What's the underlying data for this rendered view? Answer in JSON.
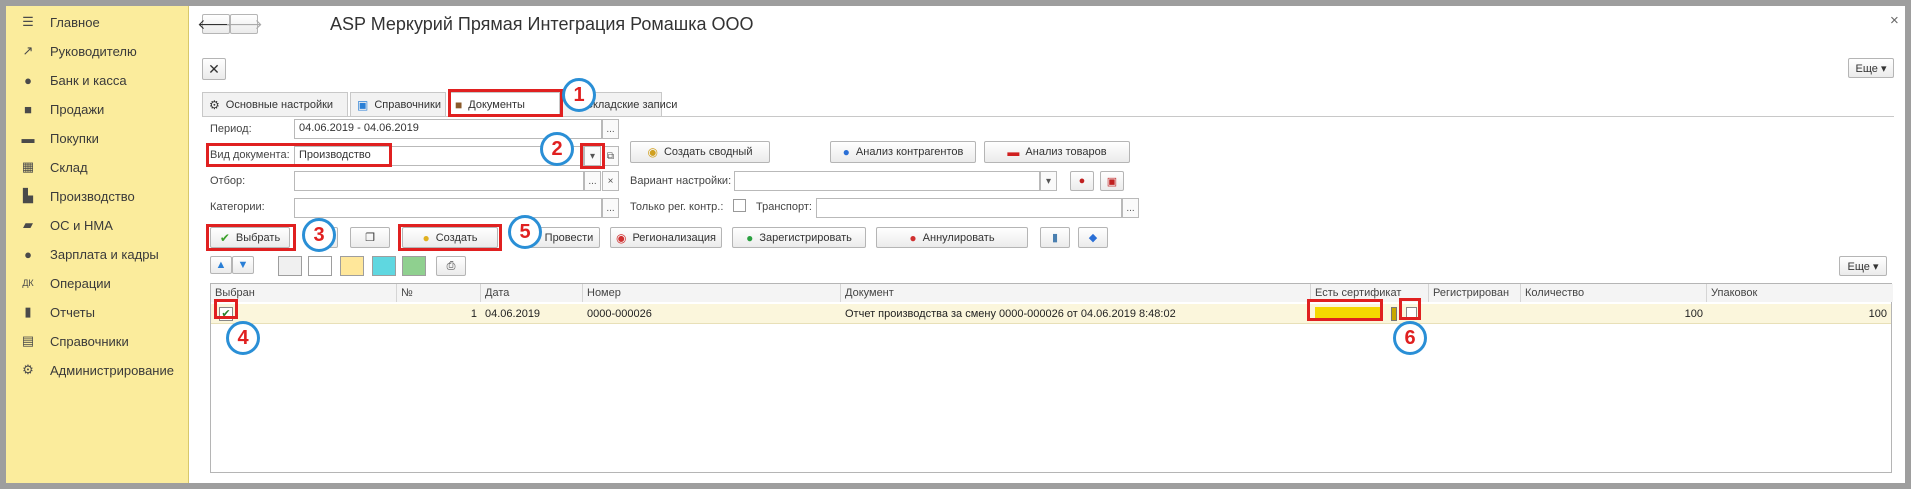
{
  "sidebar": {
    "items": [
      {
        "label": "Главное",
        "icon": "menu-icon"
      },
      {
        "label": "Руководителю",
        "icon": "chart-up-icon"
      },
      {
        "label": "Банк и касса",
        "icon": "coin-icon"
      },
      {
        "label": "Продажи",
        "icon": "bag-icon"
      },
      {
        "label": "Покупки",
        "icon": "cart-icon"
      },
      {
        "label": "Склад",
        "icon": "warehouse-icon"
      },
      {
        "label": "Производство",
        "icon": "factory-icon"
      },
      {
        "label": "ОС и НМА",
        "icon": "truck-icon"
      },
      {
        "label": "Зарплата и кадры",
        "icon": "person-icon"
      },
      {
        "label": "Операции",
        "icon": "dt-kt-icon"
      },
      {
        "label": "Отчеты",
        "icon": "bar-chart-icon"
      },
      {
        "label": "Справочники",
        "icon": "book-icon"
      },
      {
        "label": "Администрирование",
        "icon": "gear-icon"
      }
    ]
  },
  "header": {
    "title": "ASP Меркурий Прямая Интеграция Ромашка ООО",
    "back_glyph": "🡐",
    "forward_glyph": "🡒",
    "close_glyph": "×",
    "more_label": "Еще ▾"
  },
  "tabs": [
    {
      "label": "Основные настройки"
    },
    {
      "label": "Справочники"
    },
    {
      "label": "Документы"
    },
    {
      "label": "Складские записи"
    }
  ],
  "form": {
    "period_label": "Период:",
    "period_value": "04.06.2019 - 04.06.2019",
    "doc_type_label": "Вид документа:",
    "doc_type_value": "Производство",
    "filter_label": "Отбор:",
    "categories_label": "Категории:",
    "variant_label": "Вариант настройки:",
    "only_reg_label": "Только рег. контр.:",
    "transport_label": "Транспорт:",
    "ellipsis": "...",
    "clear_glyph": "×",
    "dropdown_glyph": "▾"
  },
  "buttons": {
    "create_summary": "Создать сводный",
    "analysis_counterparties": "Анализ контрагентов",
    "analysis_goods": "Анализ товаров",
    "select": "Выбрать",
    "create": "Создать",
    "post": "Провести",
    "regionalization": "Регионализация",
    "register": "Зарегистрировать",
    "annul": "Аннулировать",
    "more": "Еще ▾"
  },
  "table": {
    "columns": [
      "Выбран",
      "№",
      "Дата",
      "Номер",
      "Документ",
      "Есть сертификат",
      "Регистрирован",
      "Количество",
      "Упаковок"
    ],
    "rows": [
      {
        "selected": "✔",
        "num": "1",
        "date": "04.06.2019",
        "number": "0000-000026",
        "document": "Отчет производства за смену 0000-000026 от 04.06.2019 8:48:02",
        "quantity": "100",
        "packages": "100"
      }
    ]
  },
  "callouts": [
    "1",
    "2",
    "3",
    "4",
    "5",
    "6"
  ],
  "colors": {
    "sidebar_bg": "#fbec9c",
    "highlight_red": "#e02020",
    "callout_blue": "#2a8fd6",
    "row_highlight": "#fbf6dc",
    "certificate_yellow": "#f5d800"
  }
}
